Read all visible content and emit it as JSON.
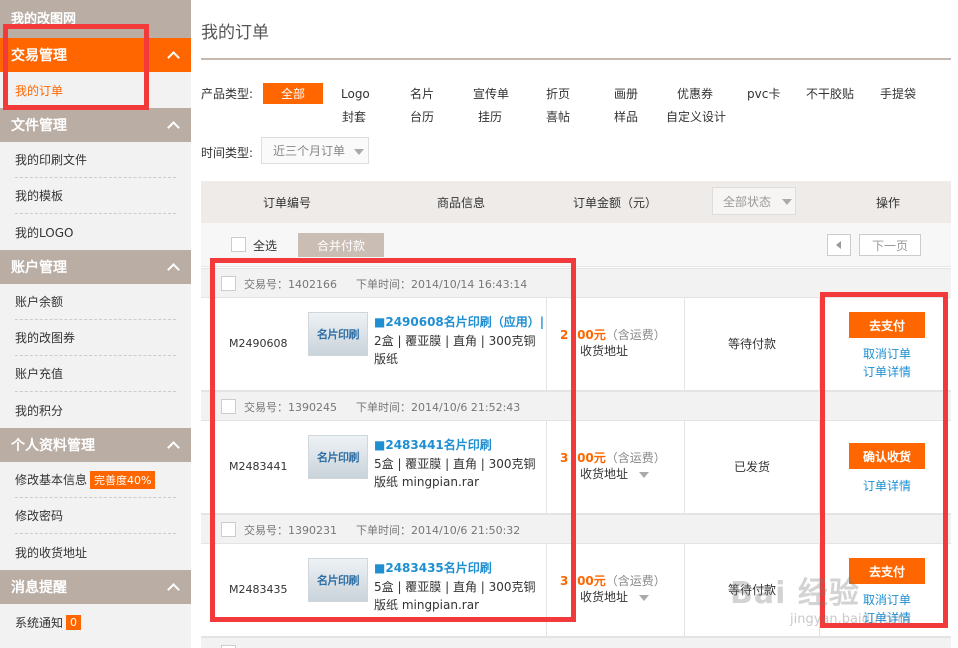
{
  "sidebar": {
    "top_link": "我的改图网",
    "sections": [
      {
        "title": "交易管理",
        "items": [
          "我的订单"
        ]
      },
      {
        "title": "文件管理",
        "items": [
          "我的印刷文件",
          "我的模板",
          "我的LOGO"
        ]
      },
      {
        "title": "账户管理",
        "items": [
          "账户余额",
          "我的改图券",
          "账户充值",
          "我的积分"
        ]
      },
      {
        "title": "个人资料管理",
        "items": [
          "修改基本信息",
          "修改密码",
          "我的收货地址"
        ],
        "badge": "完善度40%"
      },
      {
        "title": "消息提醒",
        "items": [
          "系统通知"
        ],
        "badge": "0"
      }
    ]
  },
  "main": {
    "title": "我的订单",
    "filters": {
      "product_type_label": "产品类型:",
      "product_all": "全部",
      "product_types_row1": [
        "Logo",
        "名片",
        "宣传单",
        "折页",
        "画册",
        "优惠券",
        "pvc卡",
        "不干胶贴",
        "手提袋"
      ],
      "product_types_row2": [
        "封套",
        "台历",
        "挂历",
        "喜帖",
        "样品",
        "自定义设计"
      ],
      "time_type_label": "时间类型:",
      "time_selected": "近三个月订单"
    },
    "table": {
      "headers": [
        "订单编号",
        "商品信息",
        "订单金额（元）",
        "操作"
      ],
      "status_filter": "全部状态",
      "select_all": "全选",
      "merge_pay": "合并付款",
      "next_page": "下一页"
    },
    "orders": [
      {
        "trade": "交易号：1402166",
        "time": "下单时间：2014/10/14 16:43:14",
        "order_id": "M2490608",
        "thumb_label": "名片印刷",
        "product_name": "■2490608名片印刷（应用）|",
        "product_desc": "2盒 | 覆亚膜 | 直角 | 300克铜版纸",
        "price": "2 .00元",
        "ship_note": "（含运费）",
        "address": "收货地址",
        "status": "等待付款",
        "primary_action": "去支付",
        "links": [
          "取消订单",
          "订单详情"
        ]
      },
      {
        "trade": "交易号：1390245",
        "time": "下单时间：2014/10/6 21:52:43",
        "order_id": "M2483441",
        "thumb_label": "名片印刷",
        "product_name": "■2483441名片印刷",
        "product_desc": "5盒 | 覆亚膜 | 直角 | 300克铜版纸 mingpian.rar",
        "price": "3 .00元",
        "ship_note": "（含运费）",
        "address": "收货地址",
        "status": "已发货",
        "primary_action": "确认收货",
        "links": [
          "订单详情"
        ]
      },
      {
        "trade": "交易号：1390231",
        "time": "下单时间：2014/10/6 21:50:32",
        "order_id": "M2483435",
        "thumb_label": "名片印刷",
        "product_name": "■2483435名片印刷",
        "product_desc": "5盒 | 覆亚膜 | 直角 | 300克铜版纸 mingpian.rar",
        "price": "3 .00元",
        "ship_note": "（含运费）",
        "address": "收货地址",
        "status": "等待付款",
        "primary_action": "去支付",
        "links": [
          "取消订单",
          "订单详情"
        ]
      }
    ]
  },
  "watermark": {
    "brand": "Bai 经验",
    "url": "jingyan.baidu.com"
  },
  "colors": {
    "accent": "#ff6600",
    "link": "#1f8fd2",
    "annotation": "#f23a3a",
    "sidebar_header": "#b9ada4"
  }
}
